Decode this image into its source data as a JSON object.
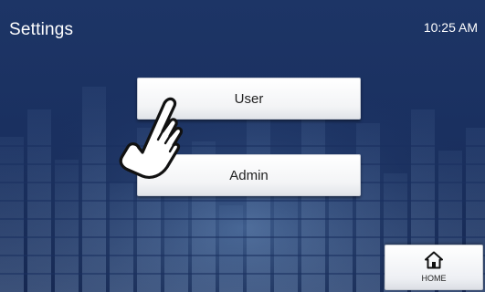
{
  "header": {
    "title": "Settings",
    "clock": "10:25 AM"
  },
  "menu": {
    "user_label": "User",
    "admin_label": "Admin"
  },
  "footer": {
    "home_label": "HOME",
    "home_icon": "home-icon"
  },
  "overlay": {
    "pointer_icon": "hand-pointer-icon"
  },
  "colors": {
    "background": "#1a3060",
    "button_face": "#ffffff",
    "text_light": "#ffffff",
    "text_dark": "#222222"
  }
}
